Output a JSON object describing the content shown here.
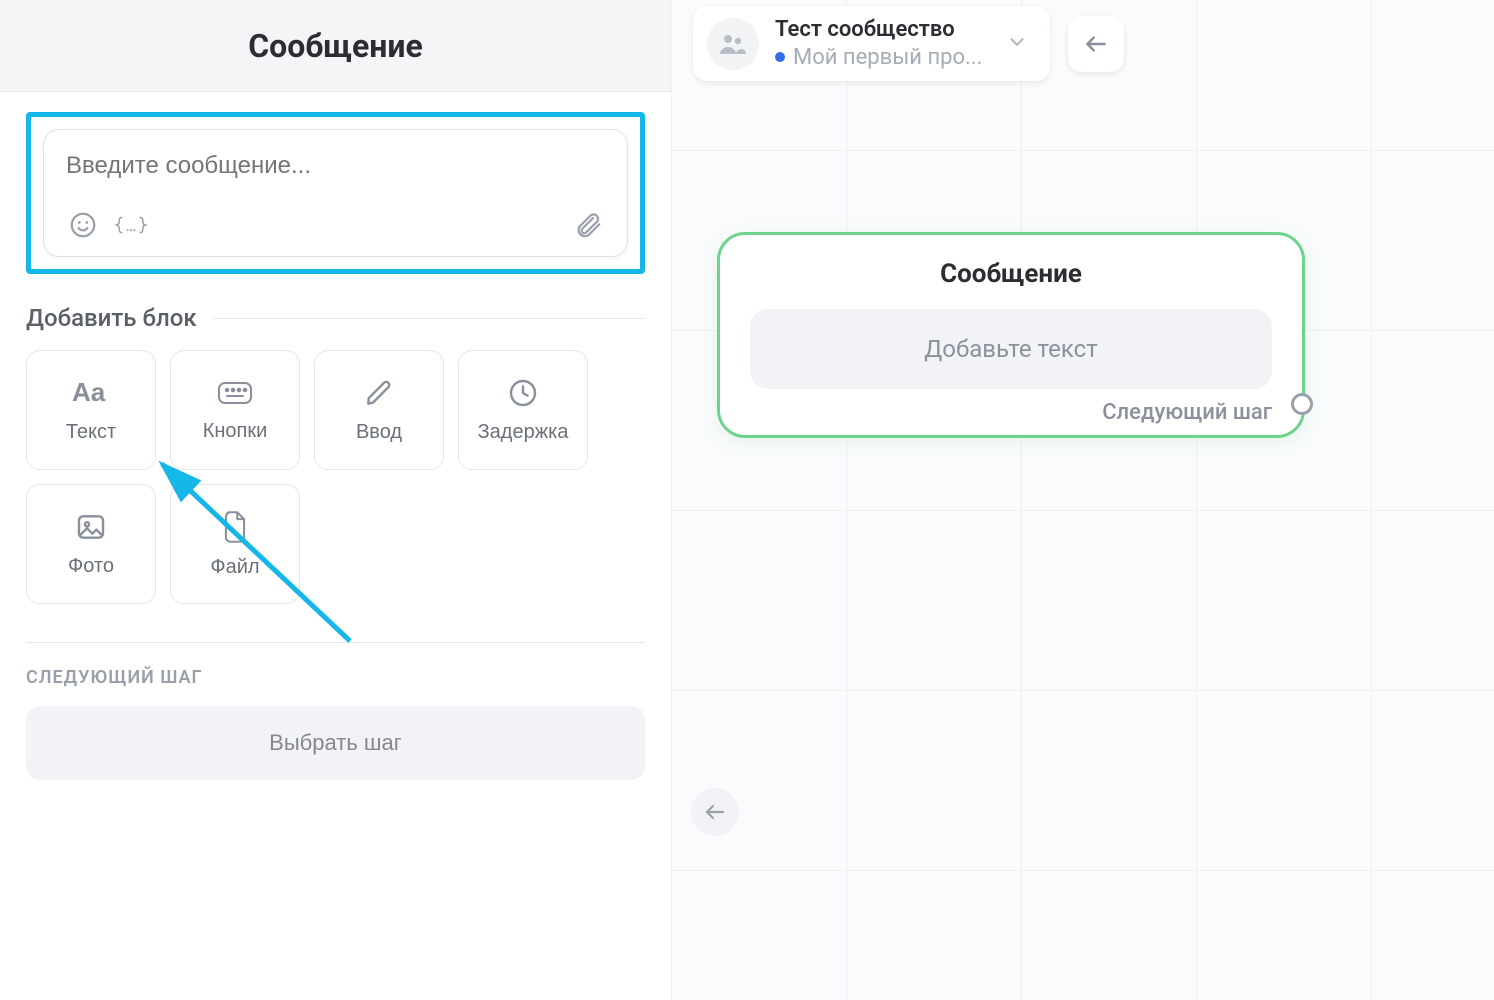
{
  "panel": {
    "title": "Сообщение",
    "message_placeholder": "Введите сообщение...",
    "add_block_label": "Добавить блок",
    "blocks": {
      "text": "Текст",
      "buttons": "Кнопки",
      "input": "Ввод",
      "delay": "Задержка",
      "photo": "Фото",
      "file": "Файл"
    },
    "next_step_label": "СЛЕДУЮЩИЙ ШАГ",
    "choose_step": "Выбрать шаг"
  },
  "canvas": {
    "community_title": "Тест сообщество",
    "community_subtitle": "Мой первый про...",
    "node": {
      "title": "Сообщение",
      "body": "Добавьте текст",
      "next": "Следующий шаг"
    }
  }
}
